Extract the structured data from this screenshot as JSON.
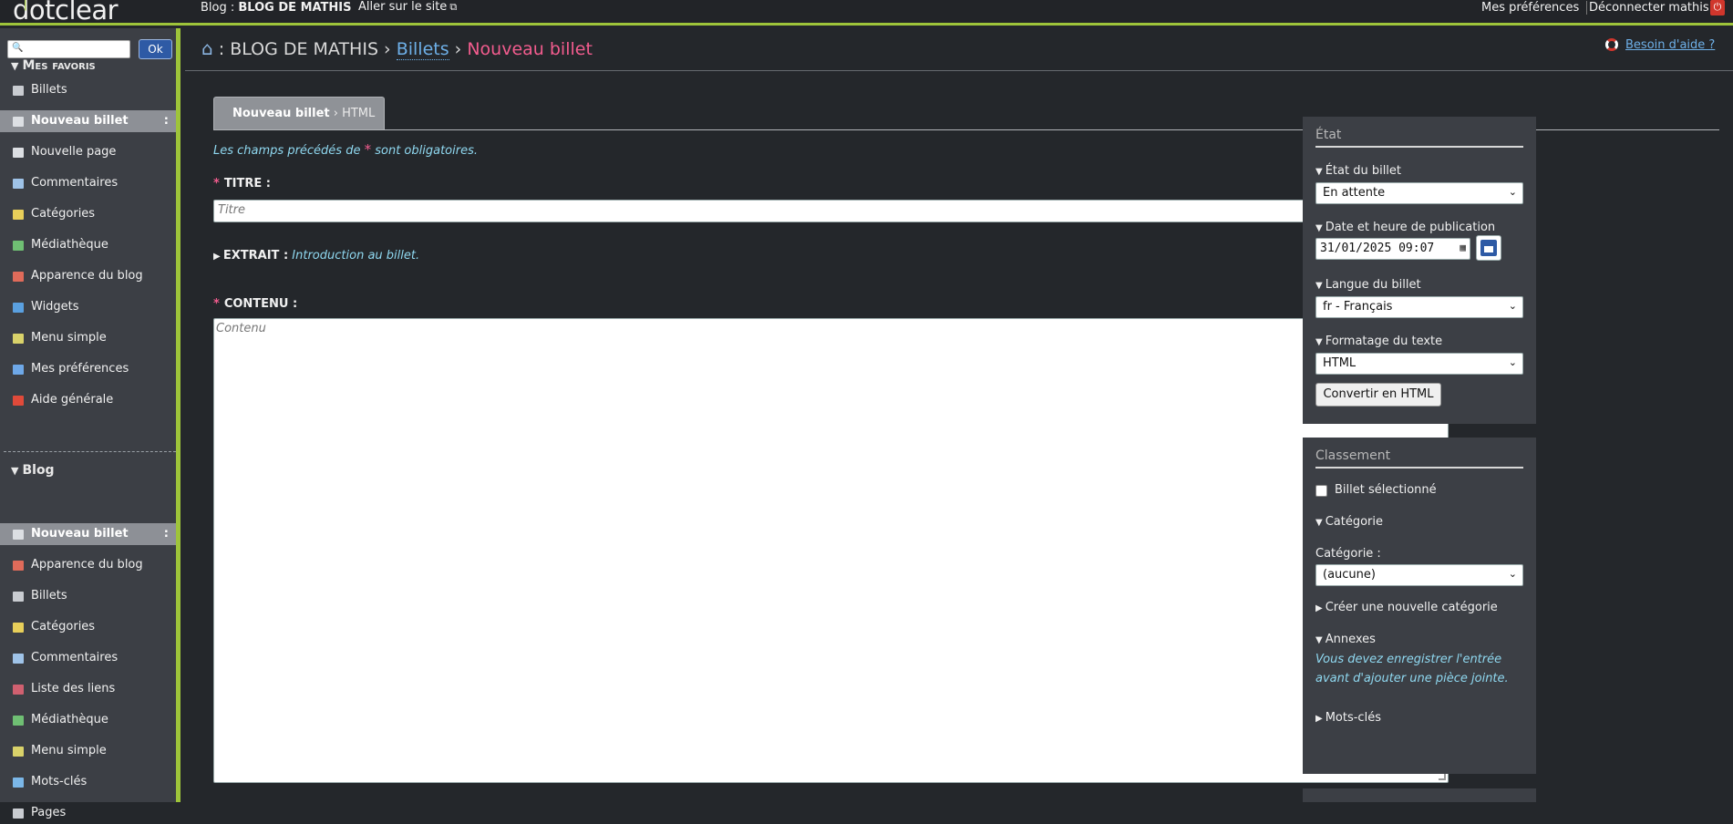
{
  "topbar": {
    "logo": "dotclear",
    "blog_prefix": "Blog : ",
    "blog_name": "BLOG DE MATHIS",
    "visit_site": "Aller sur le site",
    "preferences": "Mes préférences",
    "logout": "Déconnecter mathis"
  },
  "sidebar": {
    "search_placeholder": "",
    "ok_label": "Ok",
    "favorites_title": "Mes favoris",
    "favorites": [
      {
        "label": "Billets",
        "icon": "document-icon"
      },
      {
        "label": "Nouveau billet",
        "icon": "edit-icon",
        "active": true
      },
      {
        "label": "Nouvelle page",
        "icon": "edit-icon"
      },
      {
        "label": "Commentaires",
        "icon": "comment-icon"
      },
      {
        "label": "Catégories",
        "icon": "folder-icon"
      },
      {
        "label": "Médiathèque",
        "icon": "image-icon"
      },
      {
        "label": "Apparence du blog",
        "icon": "palette-icon"
      },
      {
        "label": "Widgets",
        "icon": "widgets-icon"
      },
      {
        "label": "Menu simple",
        "icon": "menu-icon"
      },
      {
        "label": "Mes préférences",
        "icon": "user-icon"
      },
      {
        "label": "Aide générale",
        "icon": "help-icon"
      }
    ],
    "blog_title": "Blog",
    "blog_items": [
      {
        "label": "Nouveau billet",
        "icon": "edit-icon",
        "active": true
      },
      {
        "label": "Apparence du blog",
        "icon": "palette-icon"
      },
      {
        "label": "Billets",
        "icon": "document-icon"
      },
      {
        "label": "Catégories",
        "icon": "folder-icon"
      },
      {
        "label": "Commentaires",
        "icon": "comment-icon"
      },
      {
        "label": "Liste des liens",
        "icon": "link-icon"
      },
      {
        "label": "Médiathèque",
        "icon": "image-icon"
      },
      {
        "label": "Menu simple",
        "icon": "menu-icon"
      },
      {
        "label": "Mots-clés",
        "icon": "tag-icon"
      },
      {
        "label": "Pages",
        "icon": "document-icon"
      }
    ],
    "active_dots": ":"
  },
  "main": {
    "breadcrumb": {
      "prefix": ": BLOG DE MATHIS",
      "sep1": "›",
      "billets": "Billets",
      "sep2": "›",
      "current": "Nouveau billet"
    },
    "help": "Besoin d'aide ?",
    "tab": {
      "bold": "Nouveau billet",
      "rest": " › HTML"
    },
    "required_note_before": "Les champs précédés de ",
    "required_note_star": "*",
    "required_note_after": " sont obligatoires.",
    "title_label": "TITRE :",
    "title_placeholder": "Titre",
    "excerpt_label": "EXTRAIT :",
    "excerpt_hint": "Introduction au billet.",
    "content_label": "CONTENU :",
    "content_placeholder": "Contenu"
  },
  "state_panel": {
    "title": "État",
    "status_label": "État du billet",
    "status_value": "En attente",
    "date_label": "Date et heure de publication",
    "date_value": "31/01/2025 09:07",
    "lang_label": "Langue du billet",
    "lang_value": "fr - Français",
    "format_label": "Formatage du texte",
    "format_value": "HTML",
    "convert_label": "Convertir en HTML"
  },
  "class_panel": {
    "title": "Classement",
    "selected_label": "Billet sélectionné",
    "category_section": "Catégorie",
    "category_label": "Catégorie :",
    "category_value": "(aucune)",
    "new_category": "Créer une nouvelle catégorie",
    "attachments": "Annexes",
    "attachments_note": "Vous devez enregistrer l'entrée avant d'ajouter une pièce jointe.",
    "tags": "Mots-clés"
  },
  "colors": {
    "accent": "#9ec43a",
    "link": "#6eb0e8",
    "current": "#f25c8e",
    "note": "#8fd8f0"
  }
}
